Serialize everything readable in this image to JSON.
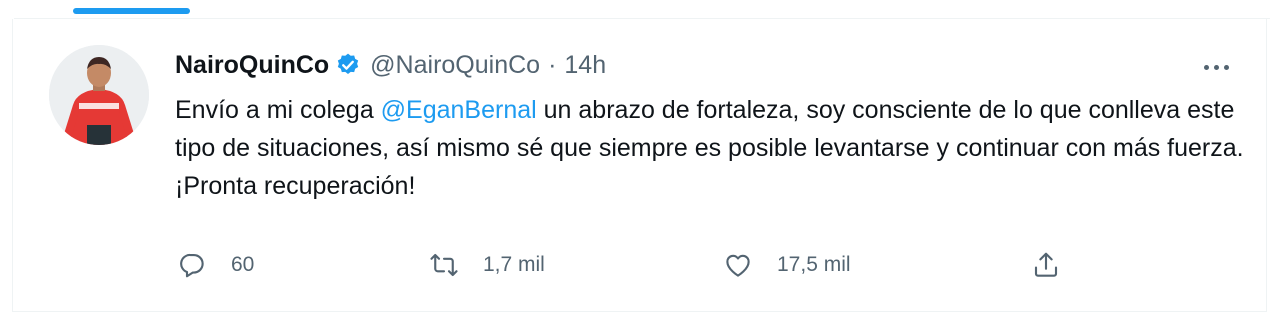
{
  "tweet": {
    "display_name": "NairoQuinCo",
    "handle": "@NairoQuinCo",
    "separator": "·",
    "time": "14h",
    "text_before": "Envío a mi colega ",
    "mention": "@EganBernal",
    "text_after": " un abrazo de fortaleza, soy consciente de lo que conlleva este tipo de situaciones, así mismo sé que siempre es posible levantarse y continuar con más fuerza. ¡Pronta recuperación!",
    "replies": "60",
    "retweets": "1,7 mil",
    "likes": "17,5 mil"
  },
  "icons": {
    "verified": "verified-badge-icon",
    "more": "more-dots-icon",
    "reply": "reply-bubble-icon",
    "retweet": "retweet-arrows-icon",
    "like": "heart-icon",
    "share": "share-upload-icon"
  },
  "colors": {
    "accent": "#1d9bf0",
    "text": "#0f1419",
    "secondary": "#536471",
    "border": "#eff3f4",
    "jersey": "#e53935"
  }
}
